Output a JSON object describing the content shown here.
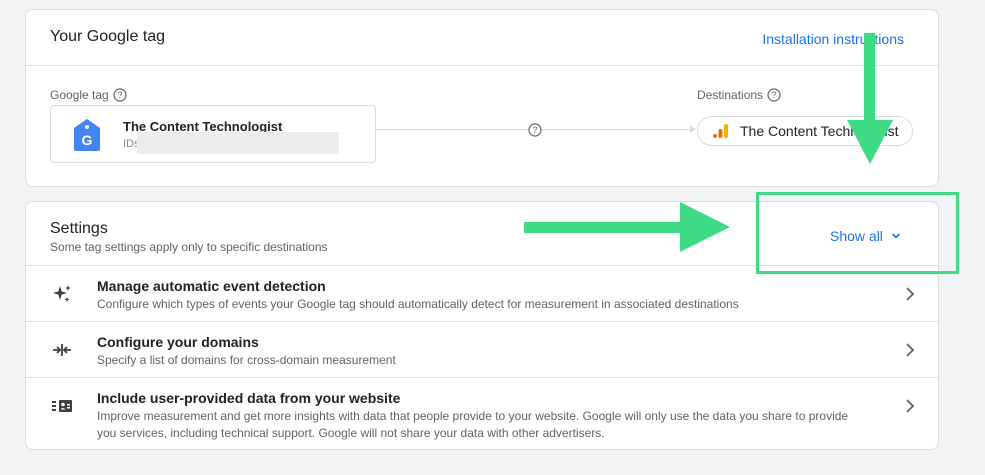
{
  "tag_card": {
    "title": "Your Google tag",
    "install_link": "Installation instructions",
    "google_tag_label": "Google tag",
    "tag_name": "The Content Technologist",
    "tag_ids_prefix": "IDs",
    "destinations_label": "Destinations",
    "destination_name": "The Content Technologist"
  },
  "settings": {
    "title": "Settings",
    "subtitle": "Some tag settings apply only to specific destinations",
    "show_all": "Show all",
    "rows": [
      {
        "icon": "sparkle-icon",
        "title": "Manage automatic event detection",
        "desc": "Configure which types of events your Google tag should automatically detect for measurement in associated destinations"
      },
      {
        "icon": "merge-arrows-icon",
        "title": "Configure your domains",
        "desc": "Specify a list of domains for cross-domain measurement"
      },
      {
        "icon": "user-data-icon",
        "title": "Include user-provided data from your website",
        "desc": "Improve measurement and get more insights with data that people provide to your website. Google will only use the data you share to provide you services, including technical support. Google will not share your data with other advertisers."
      }
    ]
  },
  "colors": {
    "link": "#1a73e8",
    "annotation": "#3ddc84",
    "analytics_orange": "#f9ab00",
    "analytics_dark_orange": "#e37400",
    "tag_blue": "#4285f4"
  }
}
